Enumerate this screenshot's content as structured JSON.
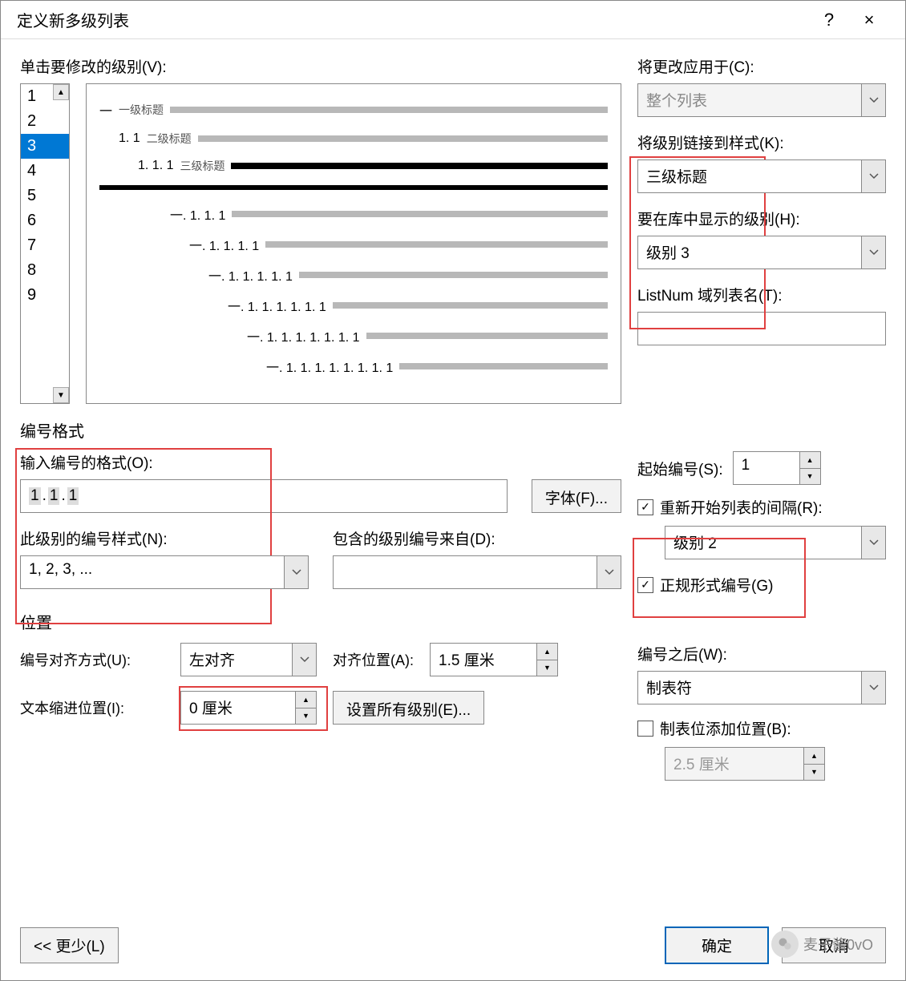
{
  "title": "定义新多级列表",
  "help_icon": "?",
  "close_icon": "×",
  "level_section_label": "单击要修改的级别(V):",
  "levels": [
    "1",
    "2",
    "3",
    "4",
    "5",
    "6",
    "7",
    "8",
    "9"
  ],
  "selected_level": "3",
  "preview_levels": [
    {
      "indent": 0,
      "num": "一",
      "txt": "一级标题"
    },
    {
      "indent": 24,
      "num": "1. 1",
      "txt": "二级标题"
    },
    {
      "indent": 48,
      "num": "1. 1. 1",
      "txt": "三级标题"
    }
  ],
  "preview_sub": [
    {
      "indent": 88,
      "num": "一. 1. 1. 1"
    },
    {
      "indent": 112,
      "num": "一. 1. 1. 1. 1"
    },
    {
      "indent": 136,
      "num": "一. 1. 1. 1. 1. 1"
    },
    {
      "indent": 160,
      "num": "一. 1. 1. 1. 1. 1. 1"
    },
    {
      "indent": 184,
      "num": "一. 1. 1. 1. 1. 1. 1. 1"
    },
    {
      "indent": 208,
      "num": "一. 1. 1. 1. 1. 1. 1. 1. 1"
    }
  ],
  "right": {
    "apply_to_label": "将更改应用于(C):",
    "apply_to_value": "整个列表",
    "link_style_label": "将级别链接到样式(K):",
    "link_style_value": "三级标题",
    "show_in_gallery_label": "要在库中显示的级别(H):",
    "show_in_gallery_value": "级别 3",
    "listnum_label": "ListNum 域列表名(T):",
    "listnum_value": ""
  },
  "number_format_section": "编号格式",
  "nf": {
    "enter_format_label": "输入编号的格式(O):",
    "enter_format_value": "1.1.1",
    "font_button": "字体(F)...",
    "number_style_label": "此级别的编号样式(N):",
    "number_style_value": "1, 2, 3, ...",
    "include_from_label": "包含的级别编号来自(D):",
    "include_from_value": "",
    "start_at_label": "起始编号(S):",
    "start_at_value": "1",
    "restart_label": "重新开始列表的间隔(R):",
    "restart_checked": true,
    "restart_value": "级别 2",
    "legal_label": "正规形式编号(G)",
    "legal_checked": true
  },
  "position_section": "位置",
  "pos": {
    "align_label": "编号对齐方式(U):",
    "align_value": "左对齐",
    "align_at_label": "对齐位置(A):",
    "align_at_value": "1.5 厘米",
    "text_indent_label": "文本缩进位置(I):",
    "text_indent_value": "0 厘米",
    "set_all_button": "设置所有级别(E)...",
    "follow_label": "编号之后(W):",
    "follow_value": "制表符",
    "tab_stop_label": "制表位添加位置(B):",
    "tab_stop_checked": false,
    "tab_stop_value": "2.5 厘米"
  },
  "footer": {
    "less": "<< 更少(L)",
    "ok": "确定",
    "cancel": "取消"
  },
  "watermark": "麦子酱0vO"
}
